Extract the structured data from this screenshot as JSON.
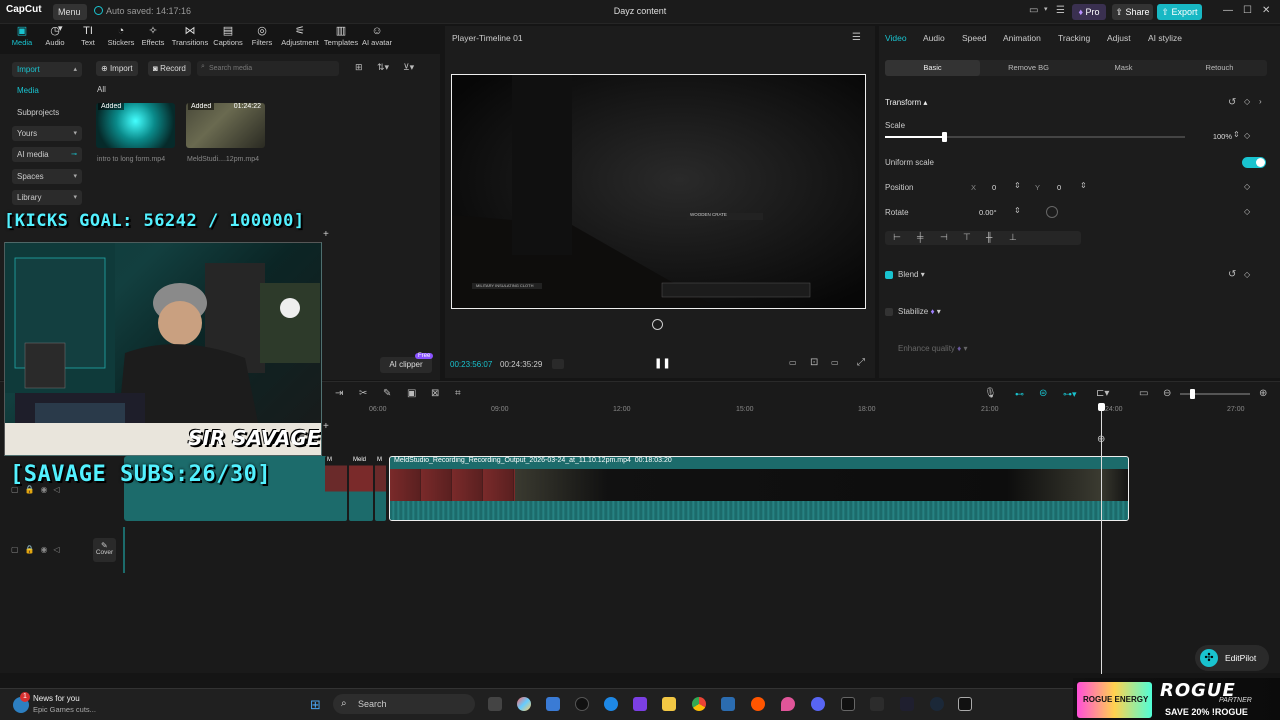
{
  "titlebar": {
    "logo": "CapCut",
    "menu": "Menu",
    "autosave": "Auto saved: 14:17:16",
    "title": "Dayz content",
    "pro": "Pro",
    "share": "Share",
    "export": "Export"
  },
  "tools": [
    {
      "label": "Media",
      "icon": "media-icon"
    },
    {
      "label": "Audio",
      "icon": "audio-icon"
    },
    {
      "label": "Text",
      "icon": "text-icon"
    },
    {
      "label": "Stickers",
      "icon": "sticker-icon"
    },
    {
      "label": "Effects",
      "icon": "effects-icon"
    },
    {
      "label": "Transitions",
      "icon": "transitions-icon"
    },
    {
      "label": "Captions",
      "icon": "captions-icon"
    },
    {
      "label": "Filters",
      "icon": "filters-icon"
    },
    {
      "label": "Adjustment",
      "icon": "adjustment-icon"
    },
    {
      "label": "Templates",
      "icon": "templates-icon"
    },
    {
      "label": "AI avatar",
      "icon": "ai-avatar-icon"
    }
  ],
  "leftnav": {
    "import": "Import",
    "media": "Media",
    "subprojects": "Subprojects",
    "yours": "Yours",
    "ai_media": "AI media",
    "spaces": "Spaces",
    "library": "Library"
  },
  "media": {
    "import_btn": "Import",
    "record_btn": "Record",
    "search_placeholder": "Search media",
    "filter_all": "All",
    "items": [
      {
        "badge": "Added",
        "name": "intro to long form.mp4",
        "duration": ""
      },
      {
        "badge": "Added",
        "name": "MeldStudi....12pm.mp4",
        "duration": "01:24:22"
      }
    ]
  },
  "overlays": {
    "kicks": "[KICKS GOAL: 56242 / 100000]",
    "subs": "[SAVAGE SUBS:26/30]",
    "name": "SIR SAVAGE"
  },
  "player": {
    "title": "Player-Timeline 01",
    "current_time": "00:23:56:07",
    "total_time": "00:24:35:29",
    "ai_clipper": "AI clipper",
    "free": "Free",
    "game_prompt": "WOODEN CRATE",
    "game_item": "MILITARY INSULATING CLOTH"
  },
  "right": {
    "tabs": [
      "Video",
      "Audio",
      "Speed",
      "Animation",
      "Tracking",
      "Adjust",
      "AI stylize"
    ],
    "subtabs": [
      "Basic",
      "Remove BG",
      "Mask",
      "Retouch"
    ],
    "transform": "Transform",
    "scale_label": "Scale",
    "scale_value": "100%",
    "scale_fraction": 0.2,
    "uniform_scale": "Uniform scale",
    "uniform_scale_on": true,
    "position_label": "Position",
    "pos_x_label": "X",
    "pos_x": "0",
    "pos_y_label": "Y",
    "pos_y": "0",
    "rotate_label": "Rotate",
    "rotate_value": "0.00°",
    "blend": "Blend",
    "stabilize": "Stabilize",
    "enhance_quality": "Enhance quality"
  },
  "timeline": {
    "ticks": [
      "06:00",
      "09:00",
      "12:00",
      "15:00",
      "18:00",
      "21:00",
      "24:00",
      "27:00"
    ],
    "clip_name": "MeldStudio_Recording_Recording_Output_2026-03-24_at_11.10.12pm.mp4",
    "clip_duration": "00:18:03:20",
    "small_clip_labels": [
      "M",
      "Meld",
      "M"
    ],
    "cover": "Cover"
  },
  "editpilot": "EditPilot",
  "taskbar": {
    "news_title": "News for you",
    "news_sub": "Epic Games cuts...",
    "news_badge": "1",
    "search": "Search"
  },
  "promo": {
    "brand": "ROGUE",
    "sub": "PARTNER",
    "offer": "SAVE 20% !ROGUE",
    "can_label": "ROGUE ENERGY"
  },
  "colors": {
    "accent": "#19c3cf",
    "overlay_text": "#53f1ff",
    "clip": "#1c6b6b"
  }
}
